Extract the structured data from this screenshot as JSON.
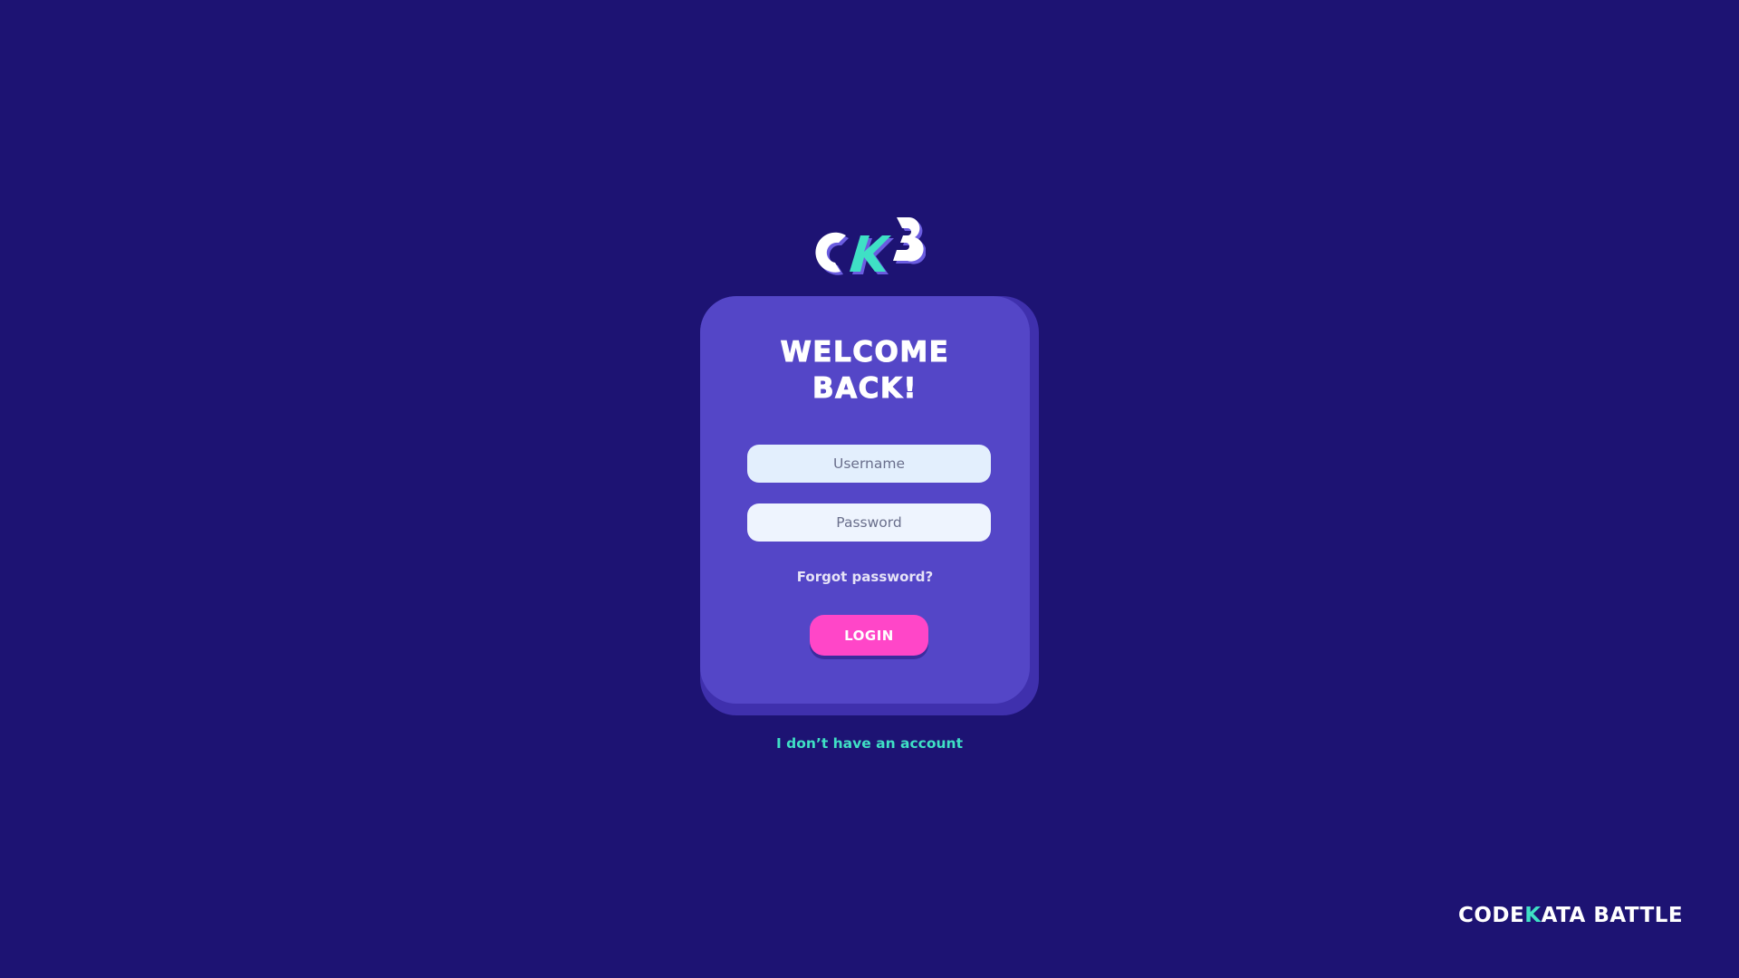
{
  "logo": {
    "icon": "ckb-logo-icon",
    "colors": {
      "primary": "#ffffff",
      "accent": "#3fe0c5",
      "shadow": "#6a5ce0"
    }
  },
  "card": {
    "title": "WELCOME\nBACK!",
    "username": {
      "placeholder": "Username",
      "value": ""
    },
    "password": {
      "placeholder": "Password",
      "value": ""
    },
    "forgot_label": "Forgot password?",
    "login_label": "LOGIN"
  },
  "signup_label": "I don’t have an account",
  "brand": {
    "part1": "CODE",
    "part2": "K",
    "part3": "ATA",
    "part4": "BATTLE"
  },
  "colors": {
    "background": "#1d1373",
    "card": "#5446c7",
    "card_shadow": "#3f30ad",
    "button": "#ff46c8",
    "link": "#3fe0c5"
  }
}
